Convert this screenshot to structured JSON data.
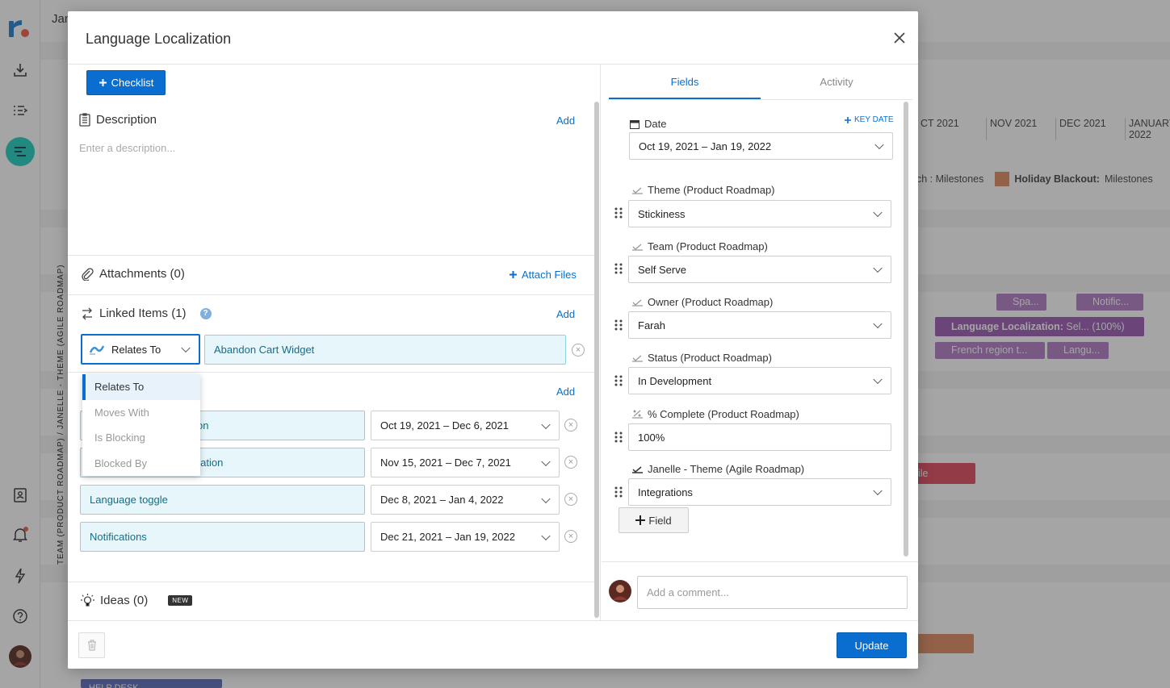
{
  "app": {
    "background_title": "Jan",
    "months": [
      "CT 2021",
      "NOV 2021",
      "DEC 2021",
      "JANUARY 2022"
    ],
    "legend": {
      "left": "ch : Milestones",
      "holiday": "Holiday Blackout:",
      "holiday_suffix": "Milestones"
    },
    "vertical_label": "TEAM (PRODUCT ROADMAP) / JANELLE - THEME (AGILE ROADMAP)",
    "bg_chips": {
      "spa": "Spa...",
      "notific": "Notific...",
      "lang_loc": "Language Localization:",
      "lang_loc_suffix": "Sel... (100%)",
      "french": "French region t...",
      "langu": "Langu...",
      "ile": "ile",
      "help_desk": "HELP DESK"
    }
  },
  "modal": {
    "title": "Language Localization",
    "checklist_label": "Checklist",
    "description": {
      "label": "Description",
      "add": "Add",
      "placeholder": "Enter a description..."
    },
    "attachments": {
      "label": "Attachments (0)",
      "attach_files": "Attach Files"
    },
    "linked_items": {
      "label": "Linked Items (1)",
      "add": "Add",
      "relation": "Relates To",
      "item": "Abandon Cart Widget",
      "dropdown_options": [
        "Relates To",
        "Moves With",
        "Is Blocking",
        "Blocked By"
      ]
    },
    "children": {
      "add": "Add",
      "rows": [
        {
          "name": "on",
          "dates": "Oct 19, 2021 – Dec 6, 2021"
        },
        {
          "name": "Spanish region translation",
          "dates": "Nov 15, 2021 – Dec 7, 2021"
        },
        {
          "name": "Language toggle",
          "dates": "Dec 8, 2021 – Jan 4, 2022"
        },
        {
          "name": "Notifications",
          "dates": "Dec 21, 2021 – Jan 19, 2022"
        }
      ]
    },
    "ideas": {
      "label": "Ideas (0)",
      "badge": "NEW"
    },
    "update": "Update"
  },
  "right_pane": {
    "tabs": [
      "Fields",
      "Activity"
    ],
    "date": {
      "label": "Date",
      "key_date": "KEY DATE",
      "value": "Oct 19, 2021 – Jan 19, 2022"
    },
    "fields": [
      {
        "label": "Theme (Product Roadmap)",
        "value": "Stickiness"
      },
      {
        "label": "Team (Product Roadmap)",
        "value": "Self Serve"
      },
      {
        "label": "Owner (Product Roadmap)",
        "value": "Farah"
      },
      {
        "label": "Status (Product Roadmap)",
        "value": "In Development"
      },
      {
        "label": "% Complete (Product Roadmap)",
        "value": "100%"
      },
      {
        "label": "Janelle - Theme (Agile Roadmap)",
        "value": "Integrations"
      }
    ],
    "add_field": "Field",
    "comment_placeholder": "Add a comment..."
  },
  "colors": {
    "accent": "#0a6ed1",
    "purple_chip": "#9b59b6",
    "red_chip": "#e04b5e",
    "orange_chip": "#e08a60",
    "teal_nav": "#1ccfbf"
  }
}
